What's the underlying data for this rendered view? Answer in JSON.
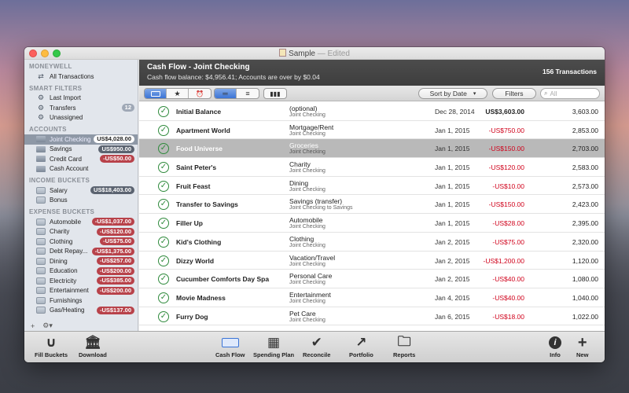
{
  "window": {
    "title": "Sample",
    "status": "— Edited"
  },
  "sidebar": {
    "sections": [
      {
        "heading": "MONEYWELL",
        "items": [
          {
            "label": "All Transactions",
            "icon": "arrows-icon"
          }
        ]
      },
      {
        "heading": "SMART FILTERS",
        "items": [
          {
            "label": "Last Import",
            "icon": "gear-icon"
          },
          {
            "label": "Transfers",
            "icon": "gear-icon",
            "badge": "12",
            "badge_type": "cnt"
          },
          {
            "label": "Unassigned",
            "icon": "gear-icon"
          }
        ]
      },
      {
        "heading": "ACCOUNTS",
        "items": [
          {
            "label": "Joint Checking",
            "icon": "account-icon",
            "badge": "US$4,028.00",
            "badge_type": "white",
            "selected": true
          },
          {
            "label": "Savings",
            "icon": "account-icon",
            "badge": "US$950.00",
            "badge_type": "pos"
          },
          {
            "label": "Credit Card",
            "icon": "account-icon",
            "badge": "-US$50.00",
            "badge_type": "neg"
          },
          {
            "label": "Cash Account",
            "icon": "account-icon"
          }
        ]
      },
      {
        "heading": "INCOME BUCKETS",
        "items": [
          {
            "label": "Salary",
            "icon": "bucket-icon",
            "badge": "US$18,403.00",
            "badge_type": "pos"
          },
          {
            "label": "Bonus",
            "icon": "bucket-icon"
          }
        ]
      },
      {
        "heading": "EXPENSE BUCKETS",
        "items": [
          {
            "label": "Automobile",
            "icon": "bucket-icon",
            "badge": "-US$1,037.00",
            "badge_type": "neg"
          },
          {
            "label": "Charity",
            "icon": "bucket-icon",
            "badge": "-US$120.00",
            "badge_type": "neg"
          },
          {
            "label": "Clothing",
            "icon": "bucket-icon",
            "badge": "-US$75.00",
            "badge_type": "neg"
          },
          {
            "label": "Debt Repay...",
            "icon": "bucket-icon",
            "badge": "-US$1,375.00",
            "badge_type": "neg"
          },
          {
            "label": "Dining",
            "icon": "bucket-icon",
            "badge": "-US$257.00",
            "badge_type": "neg"
          },
          {
            "label": "Education",
            "icon": "bucket-icon",
            "badge": "-US$200.00",
            "badge_type": "neg"
          },
          {
            "label": "Electricity",
            "icon": "bucket-icon",
            "badge": "-US$385.00",
            "badge_type": "neg"
          },
          {
            "label": "Entertainment",
            "icon": "bucket-icon",
            "badge": "-US$200.00",
            "badge_type": "neg"
          },
          {
            "label": "Furnishings",
            "icon": "bucket-icon"
          },
          {
            "label": "Gas/Heating",
            "icon": "bucket-icon",
            "badge": "-US$137.00",
            "badge_type": "neg"
          }
        ]
      }
    ],
    "footer": {
      "add": "+",
      "gear": "⚙▾"
    }
  },
  "header": {
    "title": "Cash Flow - Joint Checking",
    "subtitle": "Cash flow balance: $4,956.41; Accounts are over by $0.04",
    "count": "156 Transactions"
  },
  "toolbar": {
    "sort_label": "Sort by Date",
    "filters_label": "Filters",
    "search_placeholder": "All"
  },
  "transactions": [
    {
      "payee": "Initial Balance",
      "category": "(optional)",
      "account": "Joint Checking",
      "date": "Dec 28, 2014",
      "amount": "US$3,603.00",
      "amount_type": "pos",
      "balance": "3,603.00"
    },
    {
      "payee": "Apartment World",
      "category": "Mortgage/Rent",
      "account": "Joint Checking",
      "date": "Jan 1, 2015",
      "amount": "-US$750.00",
      "amount_type": "neg",
      "balance": "2,853.00"
    },
    {
      "payee": "Food Universe",
      "category": "Groceries",
      "account": "Joint Checking",
      "date": "Jan 1, 2015",
      "amount": "-US$150.00",
      "amount_type": "neg",
      "balance": "2,703.00",
      "selected": true
    },
    {
      "payee": "Saint Peter's",
      "category": "Charity",
      "account": "Joint Checking",
      "date": "Jan 1, 2015",
      "amount": "-US$120.00",
      "amount_type": "neg",
      "balance": "2,583.00"
    },
    {
      "payee": "Fruit Feast",
      "category": "Dining",
      "account": "Joint Checking",
      "date": "Jan 1, 2015",
      "amount": "-US$10.00",
      "amount_type": "neg",
      "balance": "2,573.00"
    },
    {
      "payee": "Transfer to Savings",
      "category": "Savings (transfer)",
      "account": "Joint Checking to Savings",
      "date": "Jan 1, 2015",
      "amount": "-US$150.00",
      "amount_type": "neg",
      "balance": "2,423.00"
    },
    {
      "payee": "Filler Up",
      "category": "Automobile",
      "account": "Joint Checking",
      "date": "Jan 1, 2015",
      "amount": "-US$28.00",
      "amount_type": "neg",
      "balance": "2,395.00"
    },
    {
      "payee": "Kid's Clothing",
      "category": "Clothing",
      "account": "Joint Checking",
      "date": "Jan 2, 2015",
      "amount": "-US$75.00",
      "amount_type": "neg",
      "balance": "2,320.00"
    },
    {
      "payee": "Dizzy World",
      "category": "Vacation/Travel",
      "account": "Joint Checking",
      "date": "Jan 2, 2015",
      "amount": "-US$1,200.00",
      "amount_type": "neg",
      "balance": "1,120.00"
    },
    {
      "payee": "Cucumber Comforts Day Spa",
      "category": "Personal Care",
      "account": "Joint Checking",
      "date": "Jan 2, 2015",
      "amount": "-US$40.00",
      "amount_type": "neg",
      "balance": "1,080.00"
    },
    {
      "payee": "Movie Madness",
      "category": "Entertainment",
      "account": "Joint Checking",
      "date": "Jan 4, 2015",
      "amount": "-US$40.00",
      "amount_type": "neg",
      "balance": "1,040.00"
    },
    {
      "payee": "Furry Dog",
      "category": "Pet Care",
      "account": "Joint Checking",
      "date": "Jan 6, 2015",
      "amount": "-US$18.00",
      "amount_type": "neg",
      "balance": "1,022.00"
    }
  ],
  "bottombar": {
    "fill_buckets": "Fill Buckets",
    "download": "Download",
    "cash_flow": "Cash Flow",
    "spending_plan": "Spending Plan",
    "reconcile": "Reconcile",
    "portfolio": "Portfolio",
    "reports": "Reports",
    "info": "Info",
    "new": "New"
  }
}
